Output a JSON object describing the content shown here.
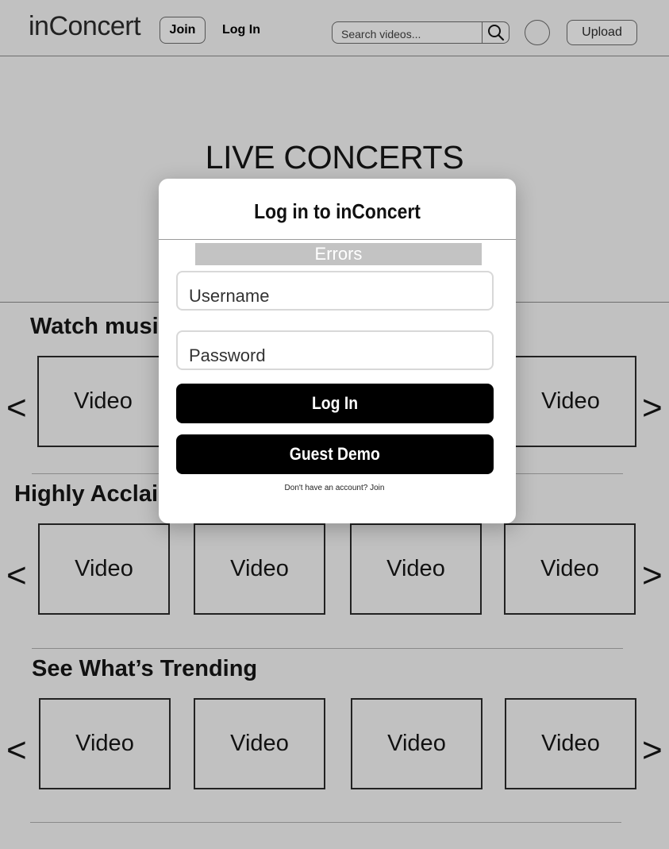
{
  "header": {
    "logo": "inConcert",
    "join_label": "Join",
    "login_label": "Log In",
    "search_placeholder": "Search videos...",
    "upload_label": "Upload"
  },
  "hero": {
    "title": "LIVE CONCERTS"
  },
  "sections": [
    {
      "title": "Watch musi",
      "videos": [
        "Video",
        "Video"
      ]
    },
    {
      "title": "Highly Acclai",
      "videos": [
        "Video",
        "Video",
        "Video",
        "Video"
      ]
    },
    {
      "title": "See What’s Trending",
      "videos": [
        "Video",
        "Video",
        "Video",
        "Video"
      ]
    }
  ],
  "carousel": {
    "prev": "<",
    "next": ">"
  },
  "modal": {
    "title": "Log in to inConcert",
    "errors": "Errors",
    "username_placeholder": "Username",
    "password_placeholder": "Password",
    "login_button": "Log In",
    "guest_button": "Guest Demo",
    "switch_text": "Don't have an account? Join"
  }
}
